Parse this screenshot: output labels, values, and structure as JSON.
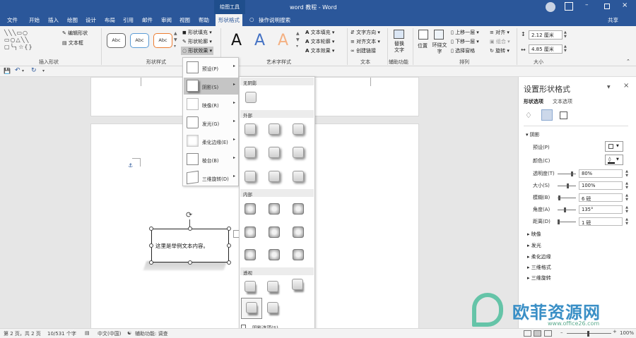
{
  "window": {
    "drawing_tools": "绘图工具",
    "title": "word 教程  -  Word",
    "share": "共享"
  },
  "tabs": [
    "文件",
    "开始",
    "插入",
    "绘图",
    "设计",
    "布局",
    "引用",
    "邮件",
    "审阅",
    "视图",
    "帮助",
    "形状格式"
  ],
  "tell_me": "操作说明搜索",
  "ribbon": {
    "insert_shapes": {
      "label": "插入形状",
      "edit_shape": "编辑形状",
      "text_box": "文本框"
    },
    "shape_styles": {
      "label": "形状样式",
      "abc": [
        "Abc",
        "Abc",
        "Abc"
      ],
      "fill": "形状填充",
      "outline": "形状轮廓",
      "effects": "形状效果"
    },
    "wordart": {
      "label": "艺术字样式",
      "letters": [
        "A",
        "A",
        "A"
      ],
      "text_fill": "文本填充",
      "text_outline": "文本轮廓",
      "text_effects": "文本效果"
    },
    "text": {
      "label": "文本",
      "direction": "文字方向",
      "align": "对齐文本",
      "link": "创建链接"
    },
    "accessibility": {
      "label": "辅助功能",
      "alt_text": "替换文字"
    },
    "arrange": {
      "label": "排列",
      "position": "位置",
      "wrap": "环绕文字",
      "forward": "上移一层",
      "backward": "下移一层",
      "pane": "选择窗格",
      "align": "对齐",
      "group": "组合",
      "rotate": "旋转"
    },
    "size": {
      "label": "大小",
      "height": "2.12 厘米",
      "width": "4.85 厘米"
    }
  },
  "effects_menu": [
    {
      "label": "预设(P)"
    },
    {
      "label": "阴影(S)"
    },
    {
      "label": "映像(R)"
    },
    {
      "label": "发光(G)"
    },
    {
      "label": "柔化边缘(E)"
    },
    {
      "label": "棱台(B)"
    },
    {
      "label": "三维旋转(D)"
    }
  ],
  "shadow_menu": {
    "none": "无阴影",
    "outer": "外部",
    "inner": "内部",
    "perspective": "透视",
    "options": "阴影选项(S)..."
  },
  "document": {
    "shape_text": "这里是举例文本内容。"
  },
  "pane": {
    "title": "设置形状格式",
    "tab_shape": "形状选项",
    "tab_text": "文本选项",
    "section_shadow": "阴影",
    "preset": "预设(P)",
    "color": "颜色(C)",
    "transparency": "透明度(T)",
    "transparency_val": "80%",
    "size": "大小(S)",
    "size_val": "100%",
    "blur": "模糊(B)",
    "blur_val": "6 磅",
    "angle": "角度(A)",
    "angle_val": "135°",
    "distance": "距离(D)",
    "distance_val": "1 磅",
    "collapsed": [
      "映像",
      "发光",
      "柔化边缘",
      "三维格式",
      "三维旋转"
    ]
  },
  "status": {
    "page": "第 2 页，共 2 页",
    "words": "10/531 个字",
    "lang": "中文(中国)",
    "access": "辅助功能: 调查",
    "zoom": "100%"
  },
  "watermark": {
    "brand": "欧菲资源网",
    "url": "www.office26.com"
  }
}
